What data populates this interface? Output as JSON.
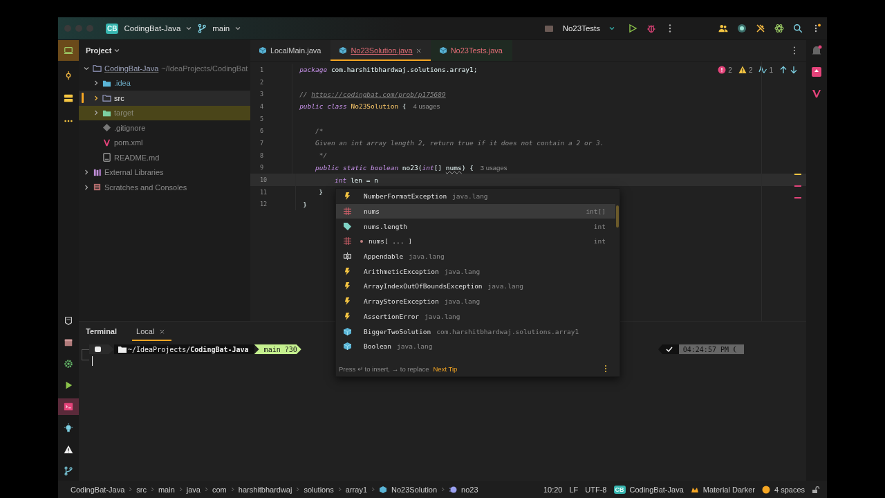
{
  "title_bar": {
    "project_badge": "CB",
    "project": "CodingBat-Java",
    "branch": "main",
    "run_config": "No23Tests"
  },
  "left_toolbar": {
    "top": [
      {
        "kind": "project",
        "selected": true
      },
      {
        "kind": "commit",
        "selected": false
      },
      {
        "kind": "structure",
        "selected": false
      },
      {
        "kind": "more",
        "selected": false
      }
    ],
    "bottom": [
      {
        "kind": "notes",
        "selected": false
      },
      {
        "kind": "box",
        "selected": false
      },
      {
        "kind": "settings",
        "selected": false
      },
      {
        "kind": "run",
        "selected": false
      },
      {
        "kind": "terminal",
        "selected": true
      },
      {
        "kind": "bulb",
        "selected": false
      },
      {
        "kind": "problems",
        "selected": false
      },
      {
        "kind": "git",
        "selected": false
      }
    ]
  },
  "project_panel": {
    "title": "Project",
    "tree": [
      {
        "label": "CodingBat-Java",
        "path": "~/IdeaProjects/CodingBat",
        "kind": "project",
        "expanded": true,
        "selected": false,
        "hovered": false,
        "children": [
          {
            "label": ".idea",
            "kind": "folder",
            "expanded": false,
            "selected": false,
            "hovered": false
          },
          {
            "label": "src",
            "kind": "source",
            "expanded": false,
            "selected": false,
            "hovered": true
          },
          {
            "label": "target",
            "kind": "excluded",
            "expanded": false,
            "selected": true,
            "hovered": false
          },
          {
            "label": ".gitignore",
            "kind": "gitignore",
            "selected": false,
            "hovered": false
          },
          {
            "label": "pom.xml",
            "kind": "maven",
            "selected": false,
            "hovered": false
          },
          {
            "label": "README.md",
            "kind": "markdown",
            "selected": false,
            "hovered": false
          }
        ]
      },
      {
        "label": "External Libraries",
        "kind": "libraries",
        "expanded": false,
        "selected": false,
        "hovered": false
      },
      {
        "label": "Scratches and Consoles",
        "kind": "scratches",
        "expanded": false,
        "selected": false,
        "hovered": false
      }
    ]
  },
  "editor": {
    "tabs": [
      {
        "label": "LocalMain.java",
        "selected": false,
        "error": false,
        "kind": "source"
      },
      {
        "label": "No23Solution.java",
        "selected": true,
        "error": true,
        "kind": "source"
      },
      {
        "label": "No23Tests.java",
        "selected": false,
        "error": true,
        "kind": "test"
      }
    ],
    "inspections": {
      "errors": "2",
      "warnings": "2",
      "typos": "1"
    },
    "lines": [
      {
        "number": "1",
        "current": false,
        "tokens": [
          {
            "text": "package",
            "kind": "keyword"
          },
          {
            "text": " com.harshitbhardwaj.solutions.array1;",
            "kind": "plain"
          }
        ]
      },
      {
        "number": "2",
        "current": false
      },
      {
        "number": "3",
        "current": false,
        "tokens": [
          {
            "text": "// ",
            "kind": "comment"
          },
          {
            "text": "https://codingbat.com/prob/p175689",
            "kind": "link"
          }
        ]
      },
      {
        "number": "4",
        "current": false,
        "tokens": [
          {
            "text": "public class ",
            "kind": "keyword"
          },
          {
            "text": "No23Solution",
            "kind": "class"
          },
          {
            "text": " {",
            "kind": "plain"
          }
        ],
        "hint": "4 usages"
      },
      {
        "number": "5",
        "current": false
      },
      {
        "number": "6",
        "current": false,
        "tokens": [
          {
            "text": "    /*",
            "kind": "comment"
          }
        ]
      },
      {
        "number": "7",
        "current": false,
        "tokens": [
          {
            "text": "    Given an int array length 2, return true if it does not contain a 2 or 3.",
            "kind": "comment"
          }
        ]
      },
      {
        "number": "8",
        "current": false,
        "tokens": [
          {
            "text": "     */",
            "kind": "comment"
          }
        ]
      },
      {
        "number": "9",
        "current": false,
        "tokens": [
          {
            "text": "    public static boolean",
            "kind": "keyword"
          },
          {
            "text": " no23(",
            "kind": "plain"
          },
          {
            "text": "int",
            "kind": "keyword"
          },
          {
            "text": "[] ",
            "kind": "plain"
          },
          {
            "text": "nums",
            "kind": "param"
          },
          {
            "text": ") {",
            "kind": "plain"
          }
        ],
        "hint": "3 usages"
      },
      {
        "number": "10",
        "current": true,
        "tokens": [
          {
            "text": "        int",
            "kind": "keyword"
          },
          {
            "text": " len = n",
            "kind": "plain"
          }
        ]
      },
      {
        "number": "11",
        "current": false,
        "tokens": [
          {
            "text": "    }",
            "kind": "plain"
          }
        ]
      },
      {
        "number": "12",
        "current": false,
        "tokens": [
          {
            "text": "}",
            "kind": "plain"
          }
        ]
      }
    ]
  },
  "completion": {
    "items": [
      {
        "kind": "exception",
        "name": "NumberFormatException",
        "detail": "java.lang",
        "selected": false
      },
      {
        "kind": "variable",
        "name": "nums",
        "type": "int[]",
        "selected": true
      },
      {
        "kind": "field",
        "name": "nums.length",
        "type": "int",
        "selected": false
      },
      {
        "kind": "indexed",
        "name": "nums[ ... ]",
        "type": "int",
        "selected": false
      },
      {
        "kind": "interface",
        "name": "Appendable",
        "detail": "java.lang",
        "selected": false
      },
      {
        "kind": "exception",
        "name": "ArithmeticException",
        "detail": "java.lang",
        "selected": false
      },
      {
        "kind": "exception",
        "name": "ArrayIndexOutOfBoundsException",
        "detail": "java.lang",
        "selected": false
      },
      {
        "kind": "exception",
        "name": "ArrayStoreException",
        "detail": "java.lang",
        "selected": false
      },
      {
        "kind": "exception",
        "name": "AssertionError",
        "detail": "java.lang",
        "selected": false
      },
      {
        "kind": "class",
        "name": "BiggerTwoSolution",
        "detail": "com.harshitbhardwaj.solutions.array1",
        "selected": false
      },
      {
        "kind": "class",
        "name": "Boolean",
        "detail": "java.lang",
        "selected": false
      }
    ],
    "footer": "Press ↵ to insert, → to replace",
    "next_tip": "Next Tip"
  },
  "terminal": {
    "title": "Terminal",
    "tabs": [
      {
        "label": "Local",
        "selected": true
      }
    ],
    "prompt": {
      "path": "~/IdeaProjects/**CodingBat-Java**",
      "git": "main ?30",
      "time": "04:24:57 PM"
    }
  },
  "status_bar": {
    "breadcrumbs": [
      {
        "label": "CodingBat-Java",
        "kind": "plain"
      },
      {
        "label": "src",
        "kind": "plain"
      },
      {
        "label": "main",
        "kind": "plain"
      },
      {
        "label": "java",
        "kind": "plain"
      },
      {
        "label": "com",
        "kind": "plain"
      },
      {
        "label": "harshitbhardwaj",
        "kind": "plain"
      },
      {
        "label": "solutions",
        "kind": "plain"
      },
      {
        "label": "array1",
        "kind": "plain"
      },
      {
        "label": "No23Solution",
        "kind": "class"
      },
      {
        "label": "no23",
        "kind": "method"
      }
    ],
    "position": "10:20",
    "line_separator": "LF",
    "encoding": "UTF-8",
    "project_badge": "CB",
    "project": "CodingBat-Java",
    "theme": "Material Darker",
    "indent": "4 spaces"
  }
}
